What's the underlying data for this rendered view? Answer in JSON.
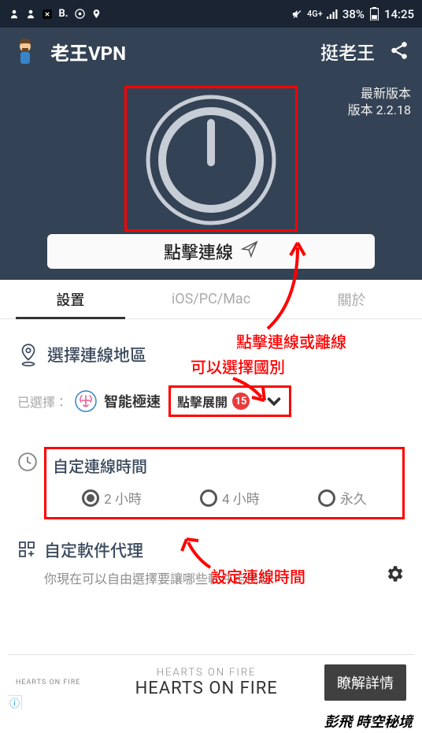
{
  "status": {
    "battery": "38%",
    "time": "14:25",
    "net": "4G+"
  },
  "header": {
    "title": "老王VPN",
    "support": "挺老王"
  },
  "version": {
    "label": "最新版本",
    "value": "版本 2.2.18"
  },
  "connect_label": "點擊連線",
  "tabs": {
    "settings": "設置",
    "platforms": "iOS/PC/Mac",
    "about": "關於"
  },
  "region": {
    "title": "選擇連線地區",
    "selected_label": "已選擇：",
    "selected_value": "智能極速",
    "expand_label": "點擊展開",
    "badge_count": "15"
  },
  "duration": {
    "title": "自定連線時間",
    "options": {
      "a": "2 小時",
      "b": "4 小時",
      "c": "永久"
    }
  },
  "proxy": {
    "title": "自定軟件代理",
    "desc": "你現在可以自由選擇要讓哪些軟件走代理。"
  },
  "ad": {
    "logo": "HEARTS ON FIRE",
    "sub": "HEARTS ON FIRE",
    "main": "HEARTS ON FIRE",
    "cta": "瞭解詳情"
  },
  "annotations": {
    "connect": "點擊連線或離線",
    "region": "可以選擇國別",
    "duration": "設定連線時間"
  },
  "watermark": "彭飛  時空秘境"
}
